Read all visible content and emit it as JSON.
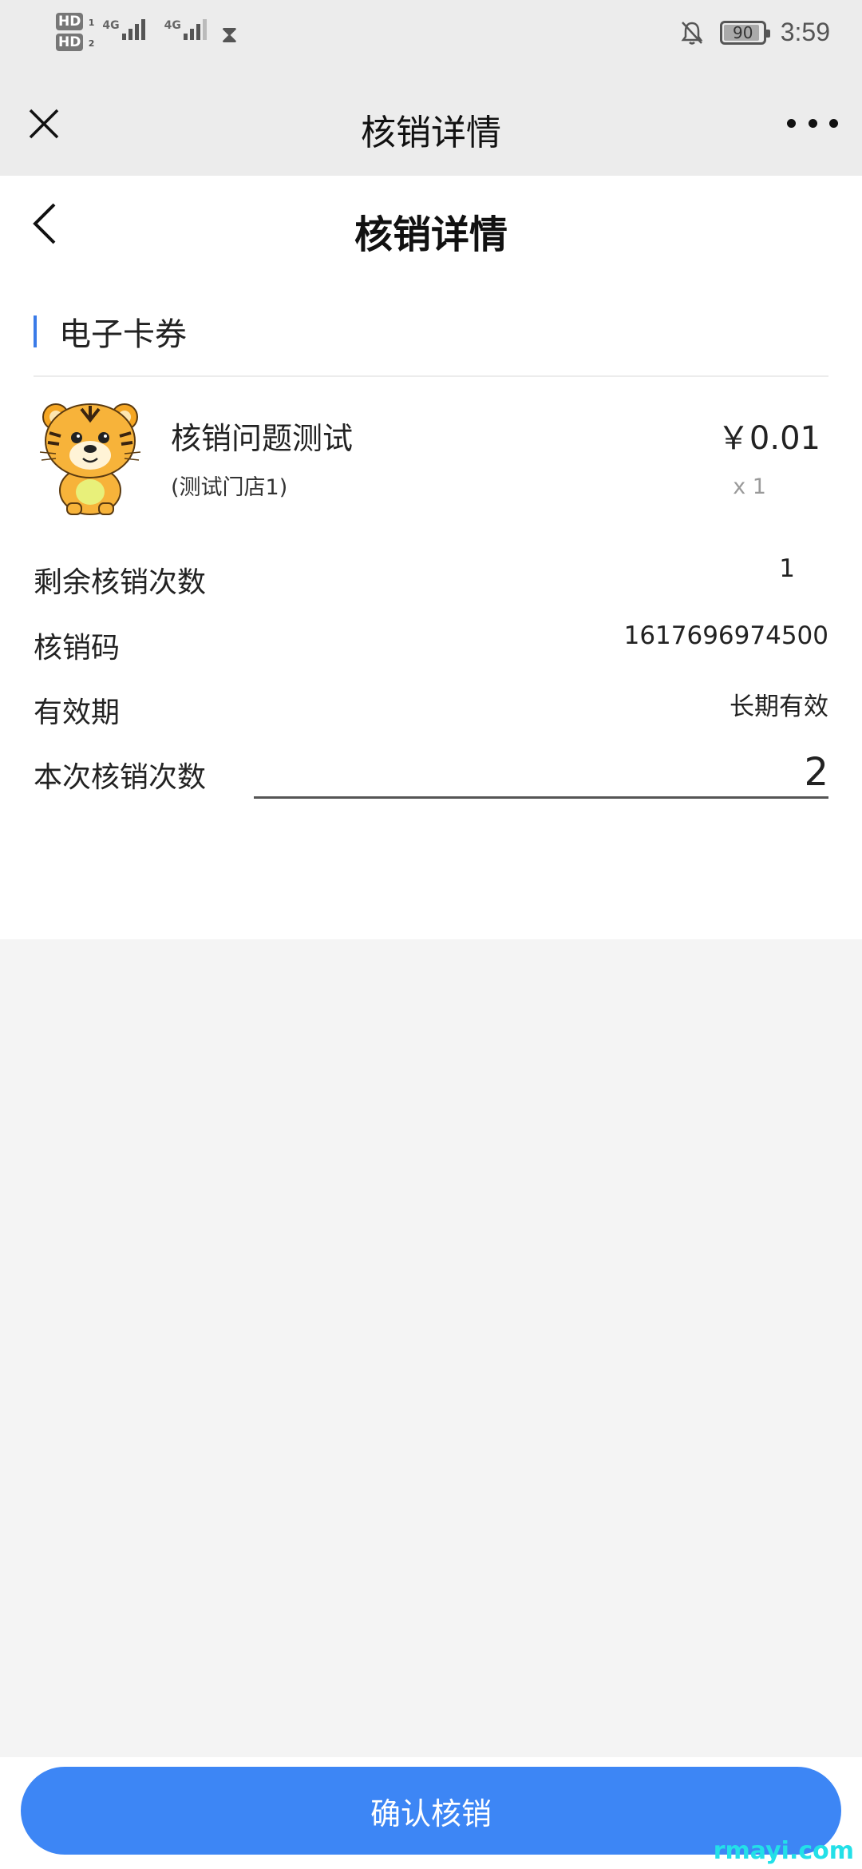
{
  "status_bar": {
    "sim1": "HD",
    "sim1_index": "1",
    "sim2": "HD",
    "sim2_index": "2",
    "net1": "4G",
    "net2": "4G",
    "battery": "90",
    "time": "3:59",
    "icons": [
      "signal-icon",
      "hourglass-icon",
      "bell-off-icon",
      "battery-icon"
    ]
  },
  "nav": {
    "title": "核销详情",
    "close_icon": "close-icon",
    "more_icon": "more-icon"
  },
  "page": {
    "title": "核销详情",
    "back_icon": "back-icon"
  },
  "section": {
    "label": "电子卡券",
    "accent_color": "#3a7be8"
  },
  "product": {
    "name": "核销问题测试",
    "store": "(测试门店1)",
    "price": "￥0.01",
    "quantity": "x 1",
    "image_icon": "tiger-mascot-image"
  },
  "details": {
    "remaining_label": "剩余核销次数",
    "remaining_value": "1",
    "code_label": "核销码",
    "code_value": "1617696974500",
    "validity_label": "有效期",
    "validity_value": "长期有效",
    "count_label": "本次核销次数",
    "count_value": "2"
  },
  "actions": {
    "confirm_label": "确认核销",
    "confirm_color": "#3d86f5"
  },
  "watermark": "rmayi.com"
}
